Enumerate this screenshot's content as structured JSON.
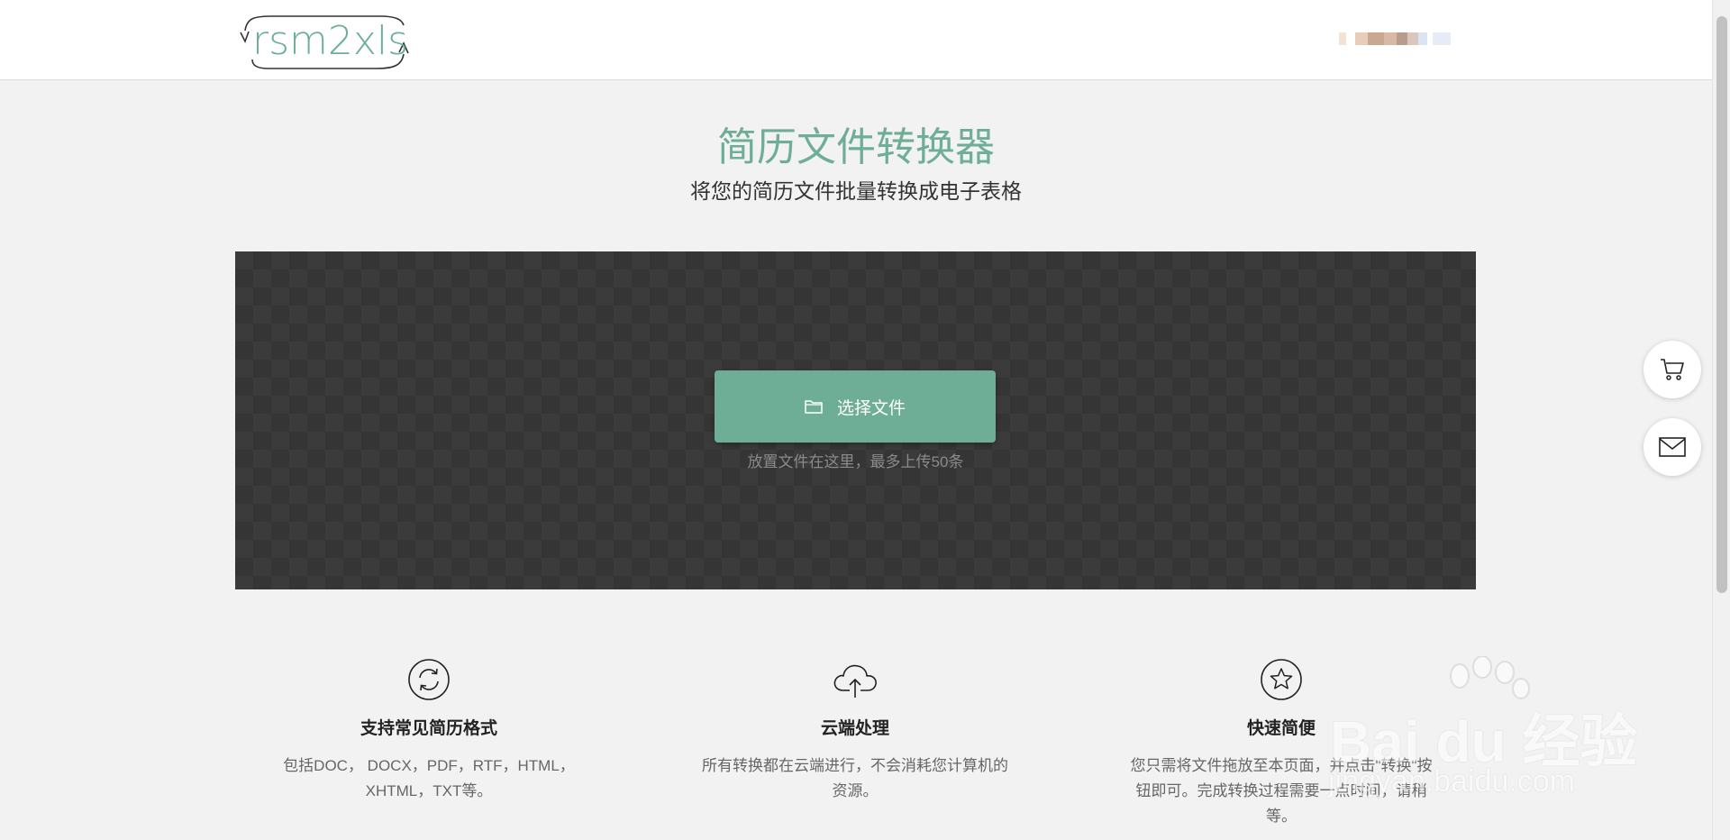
{
  "header": {
    "logo_text": "rsm2xls"
  },
  "hero": {
    "title": "简历文件转换器",
    "subtitle": "将您的简历文件批量转换成电子表格"
  },
  "upload": {
    "button_label": "选择文件",
    "hint": "放置文件在这里，最多上传50条"
  },
  "features": [
    {
      "icon": "refresh-icon",
      "title": "支持常见简历格式",
      "description": "包括DOC， DOCX，PDF，RTF，HTML，XHTML，TXT等。"
    },
    {
      "icon": "cloud-upload-icon",
      "title": "云端处理",
      "description": "所有转换都在云端进行，不会消耗您计算机的资源。"
    },
    {
      "icon": "star-icon",
      "title": "快速简便",
      "description": "您只需将文件拖放至本页面，并点击\"转换\"按钮即可。完成转换过程需要一点时间，请稍等。"
    }
  ],
  "floating": {
    "cart_icon": "cart-icon",
    "mail_icon": "mail-icon"
  },
  "watermark": {
    "brand": "Bai du 经验",
    "url": "jingyan.baidu.com"
  },
  "colors": {
    "accent": "#6eae97",
    "dropzone": "#3b3b3b",
    "background": "#f2f2f2"
  }
}
